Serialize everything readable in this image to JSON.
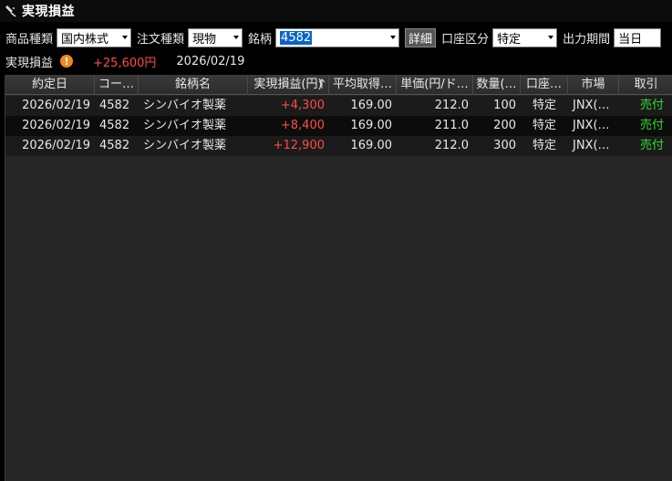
{
  "window": {
    "title": "実現損益"
  },
  "filters": {
    "product_label": "商品種類",
    "product_value": "国内株式",
    "order_label": "注文種類",
    "order_value": "現物",
    "stock_label": "銘柄",
    "stock_value": "4582",
    "detail_button": "詳細",
    "account_label": "口座区分",
    "account_value": "特定",
    "period_label": "出力期間",
    "period_value": "当日"
  },
  "summary": {
    "label": "実現損益",
    "amount": "+25,600円",
    "date": "2026/02/19"
  },
  "table": {
    "columns": [
      "約定日",
      "コー…",
      "銘柄名",
      "実現損益(円)",
      "平均取得…",
      "単価(円/ド…",
      "数量(…",
      "口座…",
      "市場",
      "取引"
    ],
    "rows": [
      [
        "2026/02/19",
        "4582",
        "シンバイオ製薬",
        "+4,300",
        "169.00",
        "212.0",
        "100",
        "特定",
        "JNX(…",
        "売付"
      ],
      [
        "2026/02/19",
        "4582",
        "シンバイオ製薬",
        "+8,400",
        "169.00",
        "211.0",
        "200",
        "特定",
        "JNX(…",
        "売付"
      ],
      [
        "2026/02/19",
        "4582",
        "シンバイオ製薬",
        "+12,900",
        "169.00",
        "212.0",
        "300",
        "特定",
        "JNX(…",
        "売付"
      ]
    ]
  },
  "colors": {
    "profit": "#ff4a4a",
    "sell": "#33dd33",
    "background": "#262626",
    "accent": "#f08a1c"
  }
}
